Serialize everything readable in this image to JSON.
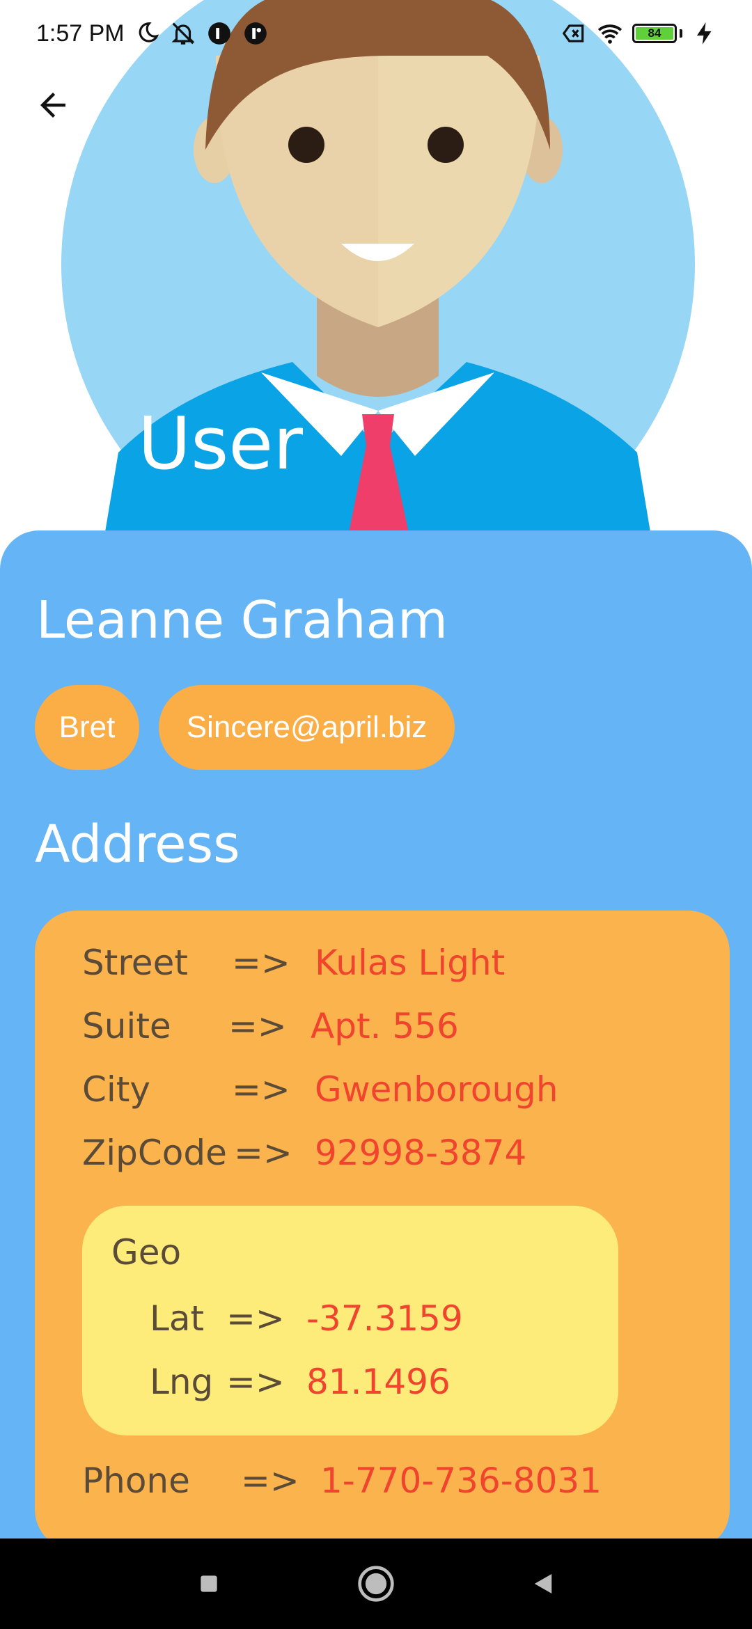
{
  "status_bar": {
    "time": "1:57 PM",
    "battery_level": "84",
    "icons": [
      "moon-icon",
      "bell-muted-icon",
      "app-icon",
      "app-icon",
      "no-sim-icon",
      "wifi-icon",
      "battery-icon",
      "charging-icon"
    ]
  },
  "header": {
    "title": "User",
    "back_icon": "arrow-back-icon",
    "avatar": "user-avatar-illustration"
  },
  "user": {
    "name": "Leanne Graham",
    "username": "Bret",
    "email": "Sincere@april.biz"
  },
  "address": {
    "section_title": "Address",
    "arrow": "=>",
    "street_label": "Street",
    "street": "Kulas Light",
    "suite_label": "Suite",
    "suite": "Apt. 556",
    "city_label": "City",
    "city": "Gwenborough",
    "zipcode_label": "ZipCode",
    "zipcode": "92998-3874",
    "geo": {
      "title": "Geo",
      "lat_label": "Lat",
      "lat": "-37.3159",
      "lng_label": "Lng",
      "lng": "81.1496"
    },
    "phone_label": "Phone",
    "phone": "1-770-736-8031"
  },
  "colors": {
    "card_background": "#64b4f6",
    "chip_background": "#fbae46",
    "address_background": "#fbb34e",
    "geo_background": "#fdeb7a",
    "value_text": "#f0442f",
    "label_text": "#5a4a38"
  },
  "nav_bar": {
    "buttons": [
      "recent-apps-icon",
      "home-icon",
      "back-triangle-icon"
    ]
  }
}
